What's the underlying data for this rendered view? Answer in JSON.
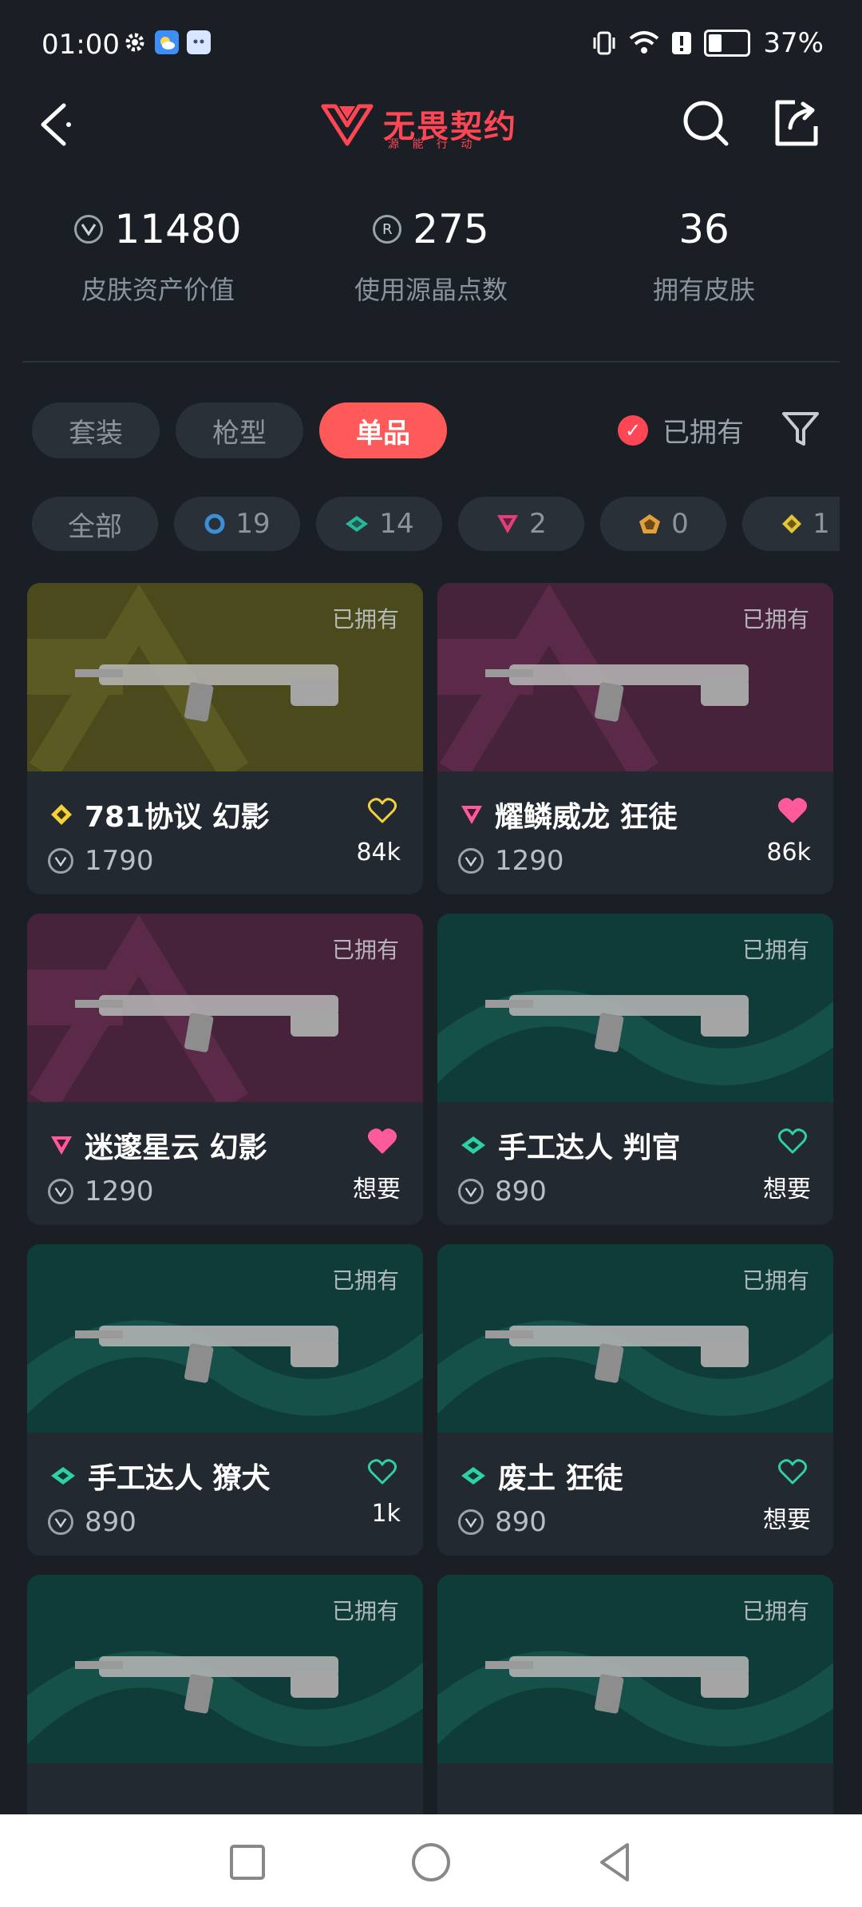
{
  "status_bar": {
    "time": "01:00",
    "battery": "37%"
  },
  "header": {
    "logo_text": "无畏契约",
    "logo_sub": "源 能 行 动"
  },
  "stats": [
    {
      "value": "11480",
      "label": "皮肤资产价值",
      "icon": "vp-icon"
    },
    {
      "value": "275",
      "label": "使用源晶点数",
      "icon": "radianite-icon"
    },
    {
      "value": "36",
      "label": "拥有皮肤",
      "icon": ""
    }
  ],
  "tabs": [
    {
      "label": "套装",
      "active": false
    },
    {
      "label": "枪型",
      "active": false
    },
    {
      "label": "单品",
      "active": true
    }
  ],
  "owned_filter": {
    "label": "已拥有",
    "checked": true
  },
  "tier_chips": [
    {
      "label": "全部",
      "count": ""
    },
    {
      "tier": "select",
      "color": "#3a8fd6",
      "count": "19"
    },
    {
      "tier": "deluxe",
      "color": "#2bb59a",
      "count": "14"
    },
    {
      "tier": "premium",
      "color": "#e0407a",
      "count": "2"
    },
    {
      "tier": "exclusive",
      "color": "#e3a03a",
      "count": "0"
    },
    {
      "tier": "ultra",
      "color": "#e7c53a",
      "count": "1"
    }
  ],
  "cards": [
    {
      "owned": "已拥有",
      "name": "781协议 幻影",
      "tier_color": "#f3d23a",
      "tier_shape": "diamond",
      "price": "1790",
      "fav": "84k",
      "fav_filled": false,
      "fav_color": "#f3d23a",
      "bg": "olive"
    },
    {
      "owned": "已拥有",
      "name": "耀鳞威龙 狂徒",
      "tier_color": "#ff5b9a",
      "tier_shape": "triangle",
      "price": "1290",
      "fav": "86k",
      "fav_filled": true,
      "fav_color": "#ff5b9a",
      "bg": "magenta"
    },
    {
      "owned": "已拥有",
      "name": "迷邃星云 幻影",
      "tier_color": "#ff5b9a",
      "tier_shape": "triangle",
      "price": "1290",
      "fav": "想要",
      "fav_filled": true,
      "fav_color": "#ff5b9a",
      "bg": "magenta"
    },
    {
      "owned": "已拥有",
      "name": "手工达人 判官",
      "tier_color": "#2fd0a6",
      "tier_shape": "eye",
      "price": "890",
      "fav": "想要",
      "fav_filled": false,
      "fav_color": "#2fd0a6",
      "bg": "teal"
    },
    {
      "owned": "已拥有",
      "name": "手工达人 獠犬",
      "tier_color": "#2fd0a6",
      "tier_shape": "eye",
      "price": "890",
      "fav": "1k",
      "fav_filled": false,
      "fav_color": "#2fd0a6",
      "bg": "teal"
    },
    {
      "owned": "已拥有",
      "name": "废土 狂徒",
      "tier_color": "#2fd0a6",
      "tier_shape": "eye",
      "price": "890",
      "fav": "想要",
      "fav_filled": false,
      "fav_color": "#2fd0a6",
      "bg": "teal"
    },
    {
      "owned": "已拥有",
      "name": "",
      "tier_color": "#2fd0a6",
      "tier_shape": "eye",
      "price": "",
      "fav": "",
      "fav_filled": false,
      "fav_color": "#2fd0a6",
      "bg": "teal"
    },
    {
      "owned": "已拥有",
      "name": "",
      "tier_color": "#2fd0a6",
      "tier_shape": "eye",
      "price": "",
      "fav": "",
      "fav_filled": false,
      "fav_color": "#2fd0a6",
      "bg": "teal"
    }
  ]
}
